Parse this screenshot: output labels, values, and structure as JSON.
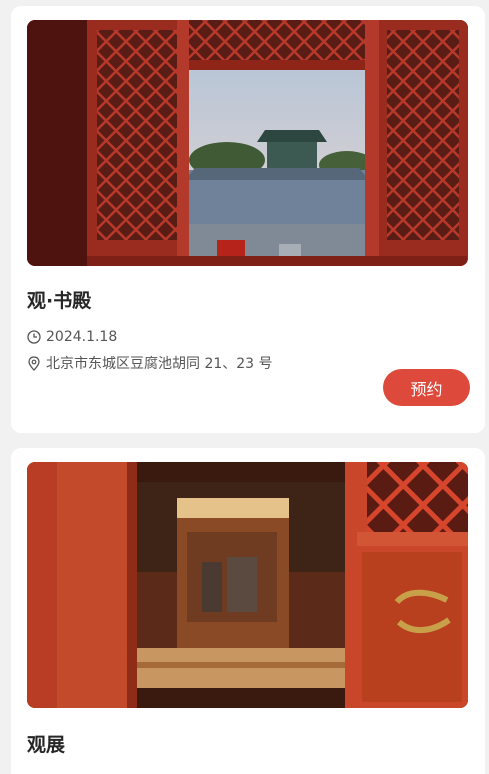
{
  "events": [
    {
      "title": "观·书殿",
      "date": "2024.1.18",
      "address": "北京市东城区豆腐池胡同 21、23 号",
      "action_label": "预约"
    },
    {
      "title": "观展"
    }
  ],
  "icons": {
    "date": "clock-icon",
    "address": "location-pin-icon"
  },
  "colors": {
    "accent": "#dd4a3b",
    "background": "#f1f1f1",
    "card": "#ffffff"
  }
}
